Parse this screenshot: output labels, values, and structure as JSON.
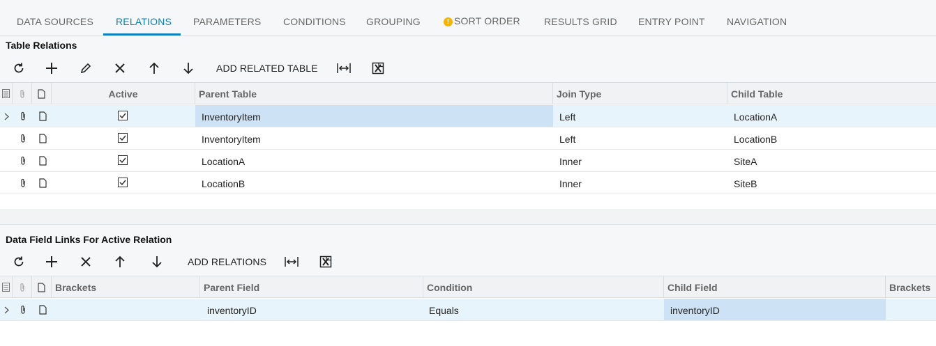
{
  "tabs": [
    {
      "label": "DATA SOURCES",
      "active": false,
      "warning": false
    },
    {
      "label": "RELATIONS",
      "active": true,
      "warning": false
    },
    {
      "label": "PARAMETERS",
      "active": false,
      "warning": false
    },
    {
      "label": "CONDITIONS",
      "active": false,
      "warning": false
    },
    {
      "label": "GROUPING",
      "active": false,
      "warning": false
    },
    {
      "label": "SORT ORDER",
      "active": false,
      "warning": true
    },
    {
      "label": "RESULTS GRID",
      "active": false,
      "warning": false
    },
    {
      "label": "ENTRY POINT",
      "active": false,
      "warning": false
    },
    {
      "label": "NAVIGATION",
      "active": false,
      "warning": false
    }
  ],
  "warning_glyph": "!",
  "table_relations": {
    "title": "Table Relations",
    "toolbar": {
      "refresh_icon": "refresh-icon",
      "add_icon": "plus-icon",
      "edit_icon": "pencil-icon",
      "delete_icon": "close-icon",
      "up_icon": "arrow-up-icon",
      "down_icon": "arrow-down-icon",
      "add_related_label": "ADD RELATED TABLE",
      "fit_icon": "fit-width-icon",
      "export_icon": "excel-export-icon"
    },
    "columns": {
      "active": "Active",
      "parent_table": "Parent Table",
      "join_type": "Join Type",
      "child_table": "Child Table"
    },
    "rows": [
      {
        "active": true,
        "parent_table": "InventoryItem",
        "join_type": "Left",
        "child_table": "LocationA",
        "selected": true
      },
      {
        "active": true,
        "parent_table": "InventoryItem",
        "join_type": "Left",
        "child_table": "LocationB",
        "selected": false
      },
      {
        "active": true,
        "parent_table": "LocationA",
        "join_type": "Inner",
        "child_table": "SiteA",
        "selected": false
      },
      {
        "active": true,
        "parent_table": "LocationB",
        "join_type": "Inner",
        "child_table": "SiteB",
        "selected": false
      }
    ]
  },
  "data_field_links": {
    "title": "Data Field Links For Active Relation",
    "toolbar": {
      "add_relations_label": "ADD RELATIONS"
    },
    "columns": {
      "brackets_open": "Brackets",
      "parent_field": "Parent Field",
      "condition": "Condition",
      "child_field": "Child Field",
      "brackets_close": "Brackets"
    },
    "rows": [
      {
        "brackets_open": "",
        "parent_field": "inventoryID",
        "condition": "Equals",
        "child_field": "inventoryID",
        "brackets_close": "",
        "selected": true
      }
    ]
  },
  "colors": {
    "accent": "#1181b9",
    "selected_row": "#e8f4fb",
    "highlight_cell": "#cde3f5",
    "warning": "#f5b400"
  }
}
